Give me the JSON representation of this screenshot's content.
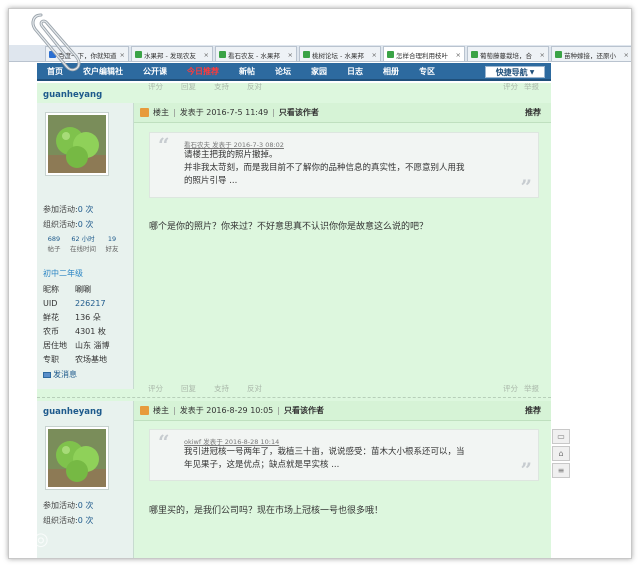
{
  "browser": {
    "tabs": [
      {
        "label": "百度一下，你就知道",
        "icon": "baidu-icon",
        "active": false
      },
      {
        "label": "水果邦 - 发现农友",
        "icon": "site-icon",
        "active": false
      },
      {
        "label": "看石农友 - 水果邦",
        "icon": "site-icon",
        "active": false
      },
      {
        "label": "桃树论坛 - 水果邦",
        "icon": "site-icon",
        "active": false
      },
      {
        "label": "怎样合理利用枝叶",
        "icon": "site-icon",
        "active": true
      },
      {
        "label": "葡萄藤蔓栽培，合",
        "icon": "site-icon",
        "active": false
      },
      {
        "label": "苗种嫁接，还原小",
        "icon": "site-icon",
        "active": false
      }
    ]
  },
  "nav": {
    "items": [
      "首页",
      "农户编辑社",
      "公开课",
      "今日推荐",
      "新帖",
      "论坛",
      "家园",
      "日志",
      "相册",
      "专区"
    ],
    "quick": "快捷导航"
  },
  "posts": [
    {
      "author": "guanheyang",
      "stats": [
        {
          "label": "参加活动:",
          "value": "0 次"
        },
        {
          "label": "组织活动:",
          "value": "0 次"
        }
      ],
      "mini": [
        {
          "num": "689",
          "label": "帖子"
        },
        {
          "num": "62 小时",
          "label": "在线时间"
        },
        {
          "num": "19",
          "label": "好友"
        }
      ],
      "level": "初中二年级",
      "profile": [
        {
          "k": "昵称",
          "v": "唰唰"
        },
        {
          "k": "UID",
          "v": "226217"
        },
        {
          "k": "鲜花",
          "v": "136 朵"
        },
        {
          "k": "农币",
          "v": "4301 枚"
        },
        {
          "k": "居住地",
          "v": "山东 淄博"
        },
        {
          "k": "专职",
          "v": "农场基地"
        }
      ],
      "send_msg": "发消息",
      "header": {
        "floor": "楼主",
        "posted": "发表于 2016-7-5 11:49",
        "only": "只看该作者",
        "rec": "推荐"
      },
      "quote": {
        "meta": "看石农夫 发表于 2016-7-3 08:02",
        "lines": [
          "请楼主把我的照片撤掉。",
          "并非我太苛刻，而是我目前不了解你的品种信息的真实性，不愿意别人用我",
          "的照片引导 ..."
        ]
      },
      "reply": "哪个是你的照片？你来过？不好意思真不认识你你是故意这么说的吧？",
      "actions": {
        "reply": "回复",
        "support": "支持",
        "oppose": "反对",
        "rate": "评分",
        "report": "举报",
        "quote": "评分"
      }
    },
    {
      "author": "guanheyang",
      "stats": [
        {
          "label": "参加活动:",
          "value": "0 次"
        },
        {
          "label": "组织活动:",
          "value": "0 次"
        }
      ],
      "header": {
        "floor": "楼主",
        "posted": "发表于 2016-8-29 10:05",
        "only": "只看该作者",
        "rec": "推荐"
      },
      "quote": {
        "meta": "okiwf 发表于 2016-8-28 10:14",
        "lines": [
          "我引进冠核一号两年了，栽植三十亩，说说感受：苗木大小根系还可以，当",
          "年见果子，这是优点；缺点就是早实核 ..."
        ]
      },
      "reply": "哪里买的，是我们公司吗？现在市场上冠核一号也很多哦！"
    }
  ],
  "top_actions": {
    "a": "评分",
    "b": "回复",
    "c": "支持",
    "d": "反对",
    "e": "评分",
    "f": "举报"
  }
}
